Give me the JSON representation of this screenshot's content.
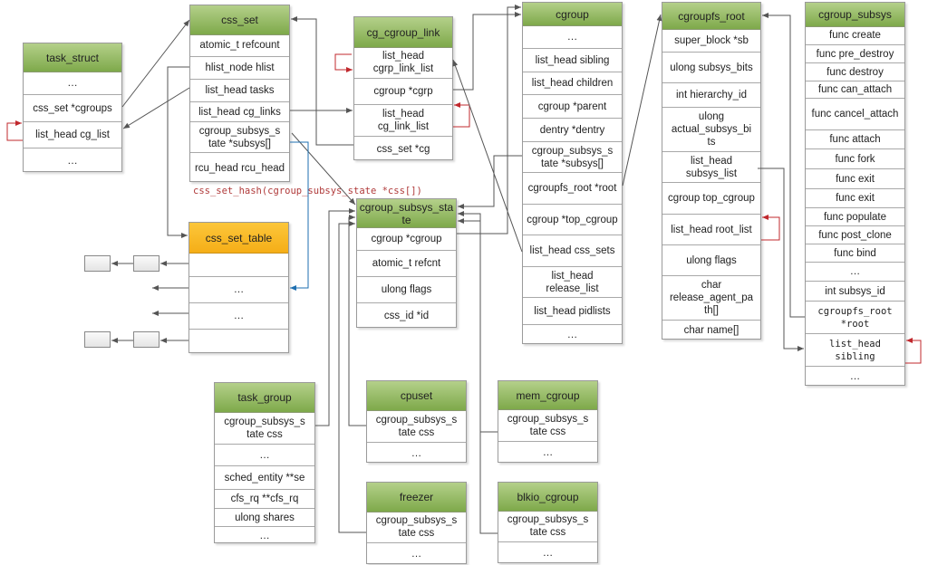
{
  "annotation": "css_set_hash(cgroup_subsys_state *css[])",
  "colors": {
    "header_green": "#8fb85a",
    "header_orange": "#f7b51f",
    "link_gray": "#555555",
    "self_loop_red": "#c0282d",
    "hash_blue": "#1e6fb0"
  },
  "boxes": [
    {
      "id": "task_struct",
      "title": "task_struct",
      "header": "green",
      "fields": [
        "…",
        "css_set *cgroups",
        "list_head cg_list",
        "…"
      ]
    },
    {
      "id": "css_set",
      "title": "css_set",
      "header": "green",
      "fields": [
        "atomic_t refcount",
        "hlist_node hlist",
        "list_head tasks",
        "list_head cg_links",
        "cgroup_subsys_s tate *subsys[]",
        "rcu_head rcu_head"
      ]
    },
    {
      "id": "cg_cgroup_link",
      "title": "cg_cgroup_link",
      "header": "green",
      "fields": [
        "list_head cgrp_link_list",
        "cgroup *cgrp",
        "list_head cg_link_list",
        "css_set *cg"
      ]
    },
    {
      "id": "cgroup",
      "title": "cgroup",
      "header": "green",
      "fields": [
        "…",
        "list_head sibling",
        "list_head children",
        "cgroup *parent",
        "dentry *dentry",
        "cgroup_subsys_s tate *subsys[]",
        "cgroupfs_root *root",
        "cgroup *top_cgroup",
        "list_head css_sets",
        "list_head release_list",
        "list_head pidlists",
        "…"
      ]
    },
    {
      "id": "cgroupfs_root",
      "title": "cgroupfs_root",
      "header": "green",
      "fields": [
        "super_block *sb",
        "ulong subsys_bits",
        "int hierarchy_id",
        "ulong actual_subsys_bi ts",
        "list_head subsys_list",
        "cgroup top_cgroup",
        "list_head root_list",
        "ulong flags",
        "char release_agent_pa th[]",
        "char name[]"
      ]
    },
    {
      "id": "cgroup_subsys",
      "title": "cgroup_subsys",
      "header": "green",
      "fields": [
        "func create",
        "func pre_destroy",
        "func destroy",
        "func can_attach",
        "func cancel_attach",
        "func attach",
        "func fork",
        "func exit",
        "func exit",
        "func populate",
        "func post_clone",
        "func bind",
        "…",
        "int subsys_id",
        "cgroupfs_root *root",
        "list_head sibling",
        "…"
      ]
    },
    {
      "id": "cgroup_subsys_state",
      "title": "cgroup_subsys_sta te",
      "header": "green",
      "fields": [
        "cgroup *cgroup",
        "atomic_t refcnt",
        "ulong flags",
        "css_id *id"
      ]
    },
    {
      "id": "css_set_table",
      "title": "css_set_table",
      "header": "orange",
      "fields": [
        "",
        "…",
        "…",
        ""
      ]
    },
    {
      "id": "task_group",
      "title": "task_group",
      "header": "green",
      "fields": [
        "cgroup_subsys_s tate css",
        "…",
        "sched_entity **se",
        "cfs_rq **cfs_rq",
        "ulong shares",
        "…"
      ]
    },
    {
      "id": "cpuset",
      "title": "cpuset",
      "header": "green",
      "fields": [
        "cgroup_subsys_s tate css",
        "…"
      ]
    },
    {
      "id": "mem_cgroup",
      "title": "mem_cgroup",
      "header": "green",
      "fields": [
        "cgroup_subsys_s tate css",
        "…"
      ]
    },
    {
      "id": "freezer",
      "title": "freezer",
      "header": "green",
      "fields": [
        "cgroup_subsys_s tate css",
        "…"
      ]
    },
    {
      "id": "blkio_cgroup",
      "title": "blkio_cgroup",
      "header": "green",
      "fields": [
        "cgroup_subsys_s tate css",
        "…"
      ]
    }
  ]
}
